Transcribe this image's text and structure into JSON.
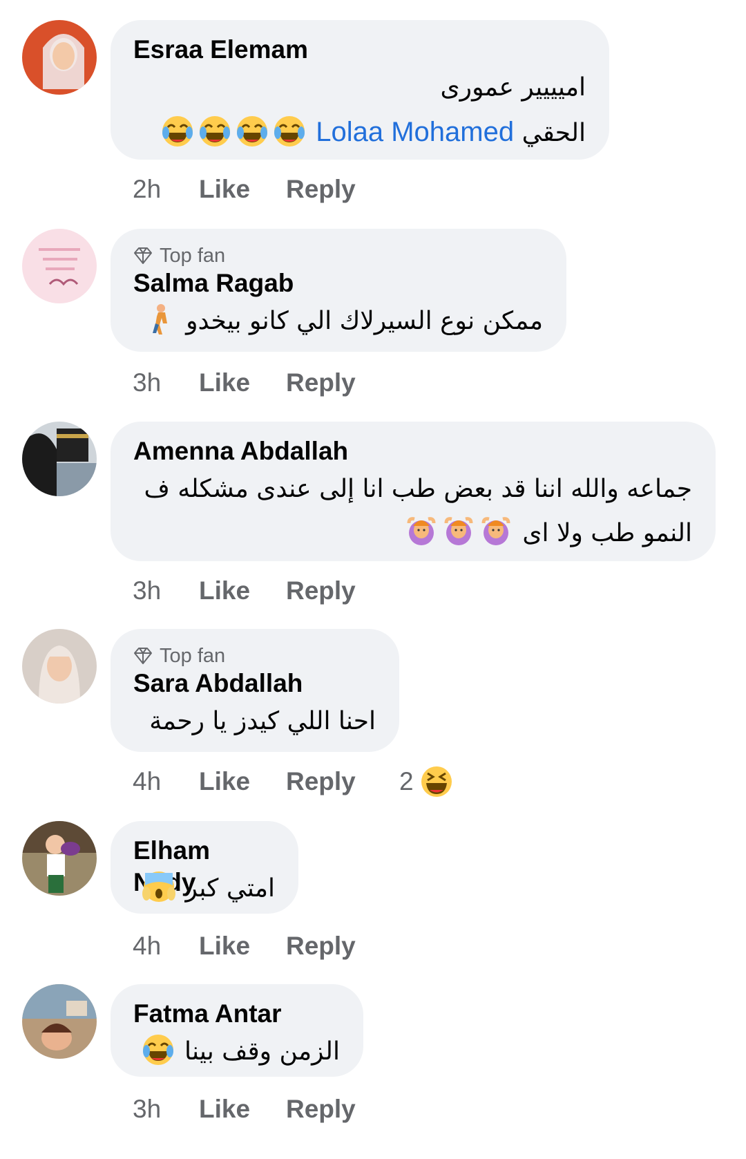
{
  "comments": [
    {
      "author": "Esraa Elemam",
      "top_fan": false,
      "lines": [
        "اميييير عمورى",
        "الحقي"
      ],
      "mention": "Lolaa Mohamed",
      "time": "2h",
      "like": "Like",
      "reply": "Reply"
    },
    {
      "author": "Salma Ragab",
      "top_fan": true,
      "badge": "Top fan",
      "lines": [
        "ممكن نوع السيرلاك الي كانو بيخدو"
      ],
      "time": "3h",
      "like": "Like",
      "reply": "Reply"
    },
    {
      "author": "Amenna Abdallah",
      "top_fan": false,
      "lines": [
        "جماعه والله اننا قد بعض طب انا إلى عندى مشكله ف",
        "النمو طب ولا اى"
      ],
      "time": "3h",
      "like": "Like",
      "reply": "Reply"
    },
    {
      "author": "Sara Abdallah",
      "top_fan": true,
      "badge": "Top fan",
      "lines": [
        "احنا اللي كيدز يا رحمة"
      ],
      "time": "4h",
      "like": "Like",
      "reply": "Reply",
      "reaction_count": "2"
    },
    {
      "author": "Elham Nady",
      "top_fan": false,
      "lines": [
        "امتي كبر"
      ],
      "time": "4h",
      "like": "Like",
      "reply": "Reply"
    },
    {
      "author": "Fatma Antar",
      "top_fan": false,
      "lines": [
        "الزمن وقف بينا"
      ],
      "time": "3h",
      "like": "Like",
      "reply": "Reply"
    }
  ],
  "icons": {
    "top_fan": "diamond-icon",
    "laugh_emoji": "face-with-tears-of-joy",
    "walking_emoji": "person-walking",
    "hands_on_head_emoji": "person-gesturing-ok",
    "shock_emoji": "face-screaming-in-fear",
    "reaction": "grinning-squinting-face"
  },
  "colors": {
    "bubble": "#f0f2f5",
    "meta": "#65676b",
    "mention": "#216fdb"
  }
}
